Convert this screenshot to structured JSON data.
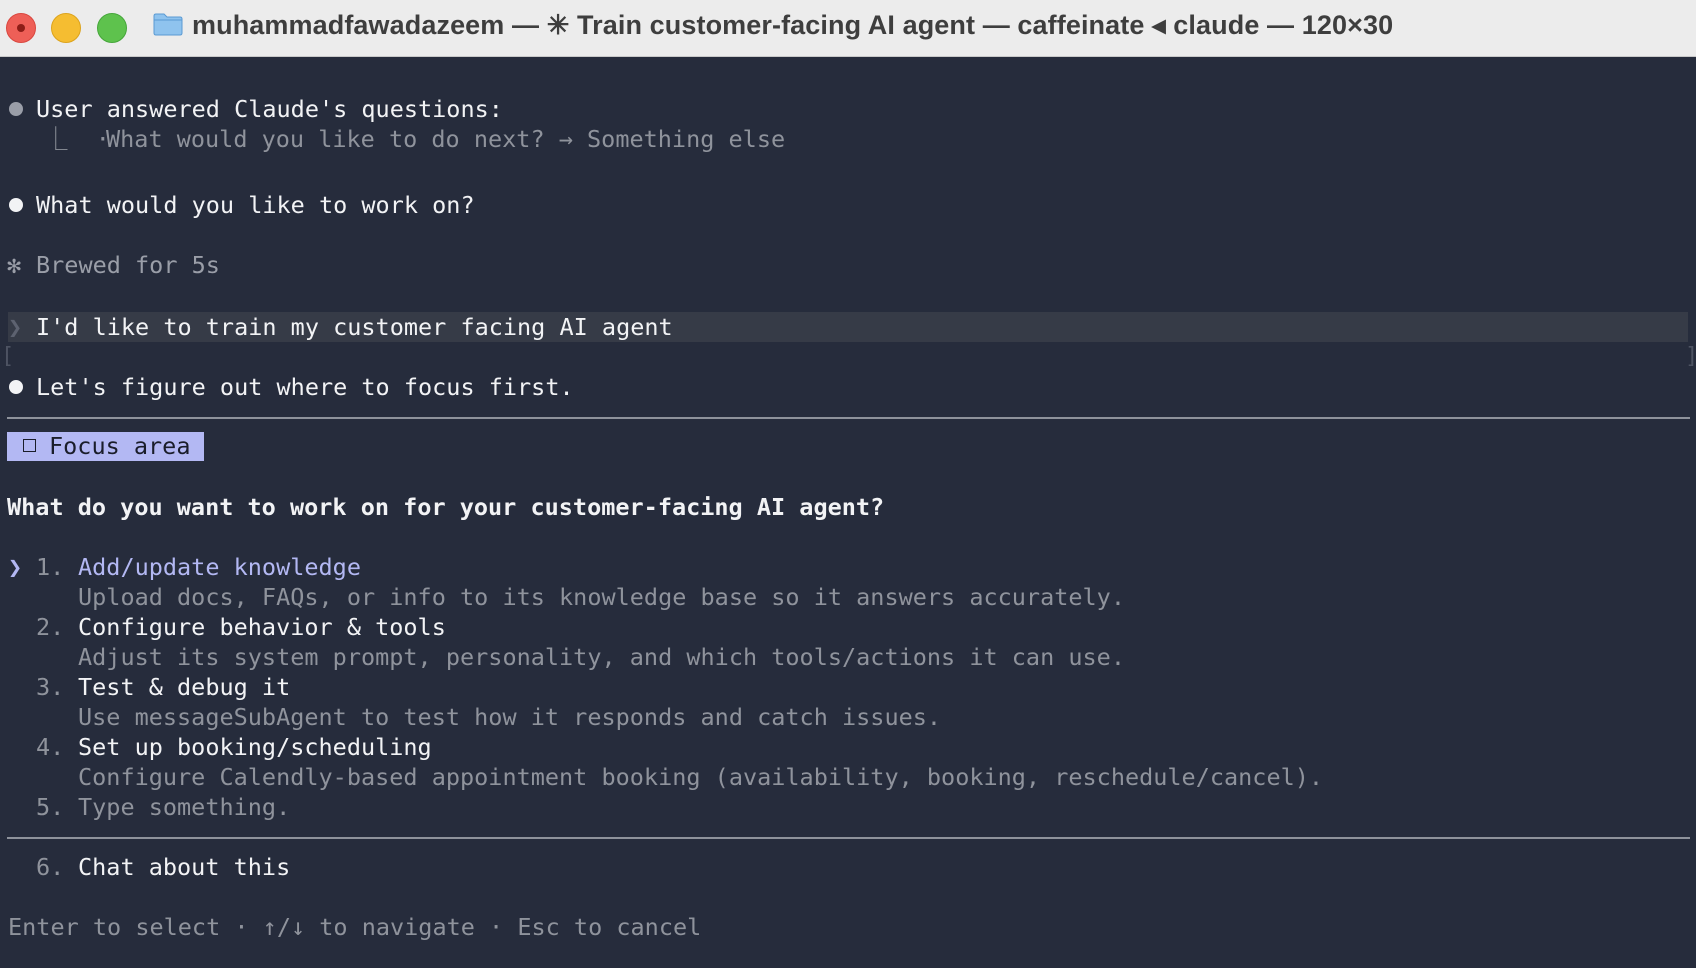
{
  "window": {
    "title": "muhammadfawadazeem — ✳ Train customer-facing AI agent — caffeinate ◂ claude — 120×30"
  },
  "history": {
    "answered_heading": "User answered Claude's questions:",
    "answered_detail_prefix": "⎿  · ",
    "answered_detail": "What would you like to do next? → Something else",
    "assistant_question": "What would you like to work on?",
    "brew_glyph": "✻",
    "brew_status": "Brewed for 5s",
    "prompt_glyph": "❯",
    "user_message": "I'd like to train my customer facing AI agent",
    "assistant_reply": "Let's figure out where to focus first."
  },
  "question": {
    "badge_label": "Focus area",
    "text": "What do you want to work on for your customer-facing AI agent?",
    "cursor": "❯",
    "options": [
      {
        "number": "1.",
        "label": "Add/update knowledge",
        "description": "Upload docs, FAQs, or info to its knowledge base so it answers accurately."
      },
      {
        "number": "2.",
        "label": "Configure behavior & tools",
        "description": "Adjust its system prompt, personality, and which tools/actions it can use."
      },
      {
        "number": "3.",
        "label": "Test & debug it",
        "description": "Use messageSubAgent to test how it responds and catch issues."
      },
      {
        "number": "4.",
        "label": "Set up booking/scheduling",
        "description": "Configure Calendly-based appointment booking (availability, booking, reschedule/cancel)."
      },
      {
        "number": "5.",
        "label": "Type something."
      }
    ],
    "chat_option": {
      "number": "6.",
      "label": "Chat about this"
    },
    "hint": "Enter to select · ↑/↓ to navigate · Esc to cancel"
  },
  "colors": {
    "background": "#262c3c",
    "accent": "#b3b8f3",
    "dim_text": "#8f939c"
  }
}
